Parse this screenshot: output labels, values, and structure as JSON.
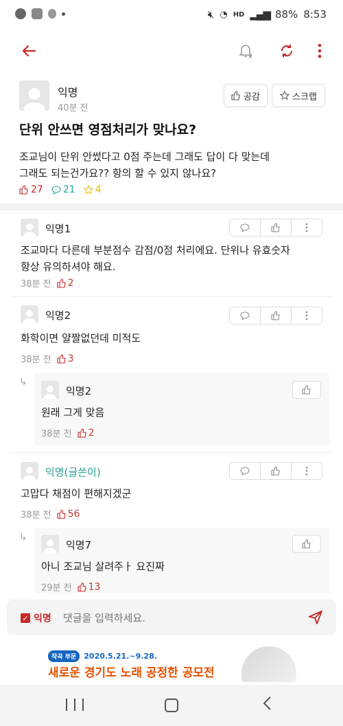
{
  "status_bar": {
    "battery": "88%",
    "time": "8:53",
    "hd_label": "HD"
  },
  "post": {
    "author": "익명",
    "time": "40분 전",
    "like_button": "공감",
    "scrap_button": "스크랩",
    "title": "단위 안쓰면 영점처리가 맞나요?",
    "body_line1": "조교님이 단위 안썼다고 0점 주는데 그래도 답이 다 맞는데",
    "body_line2": "그래도 되는건가요?? 항의 할 수 있지 않나요?",
    "likes": "27",
    "comments": "21",
    "scraps": "4"
  },
  "comments": [
    {
      "author": "익명1",
      "line1": "조교마다 다른데 부분점수 감점/0점 처리에요. 단위나 유효숫자",
      "line2": "항상 유의하셔야 해요.",
      "time": "38분 전",
      "likes": "2"
    },
    {
      "author": "익명2",
      "line1": "화학이면 얄짤없던데 미적도",
      "line2": "",
      "time": "38분 전",
      "likes": "3"
    },
    {
      "author": "익명2",
      "line1": "원래 그게 맞음",
      "line2": "",
      "time": "38분 전",
      "likes": "2"
    },
    {
      "author": "익명(글쓴이)",
      "line1": "고맙다 채점이 편해지겠군",
      "line2": "",
      "time": "38분 전",
      "likes": "56"
    },
    {
      "author": "익명7",
      "line1": "아니 조교님 살려주ㅏ 요진짜",
      "line2": "",
      "time": "29분 전",
      "likes": "13"
    }
  ],
  "input": {
    "anon_label": "익명",
    "placeholder": "댓글을 입력하세요."
  },
  "banner": {
    "tag": "작곡 부문",
    "dates": "2020.5.21.~9.28.",
    "headline": "새로운 경기도 노래 공정한 공모전"
  },
  "colors": {
    "accent": "#c62828",
    "writer_name": "#2a9d8f",
    "comment_icon": "#26a69a",
    "scrap_icon": "#e6b800"
  }
}
